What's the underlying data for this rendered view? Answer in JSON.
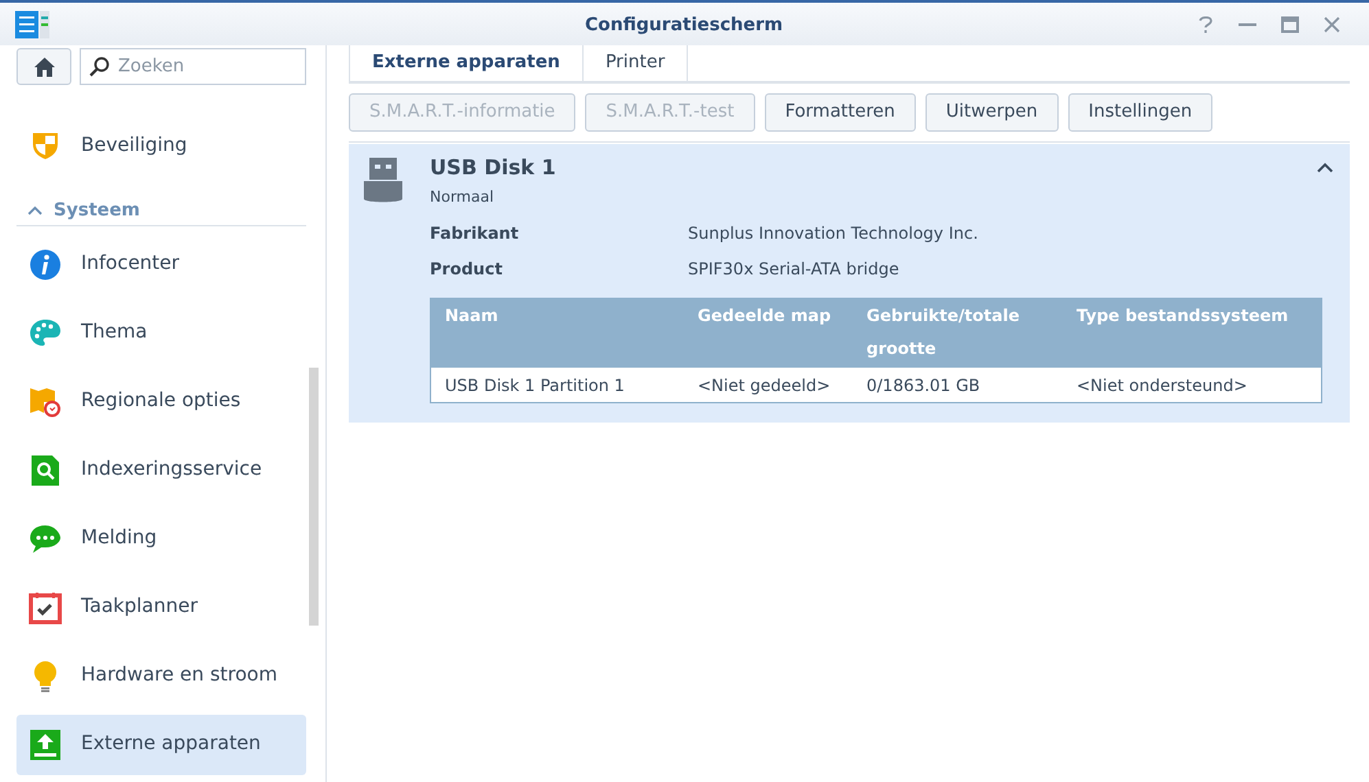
{
  "window": {
    "title": "Configuratiescherm"
  },
  "search": {
    "placeholder": "Zoeken"
  },
  "sidebar": {
    "items": [
      {
        "kind": "shield",
        "label": "Beveiliging",
        "selected": false
      },
      {
        "kind": "group",
        "label": "Systeem",
        "expanded": true
      },
      {
        "kind": "info",
        "label": "Infocenter",
        "selected": false
      },
      {
        "kind": "palette",
        "label": "Thema",
        "selected": false
      },
      {
        "kind": "map",
        "label": "Regionale opties",
        "selected": false
      },
      {
        "kind": "index",
        "label": "Indexeringsservice",
        "selected": false
      },
      {
        "kind": "chat",
        "label": "Melding",
        "selected": false
      },
      {
        "kind": "calendar",
        "label": "Taakplanner",
        "selected": false
      },
      {
        "kind": "bulb",
        "label": "Hardware en stroom",
        "selected": false
      },
      {
        "kind": "upload",
        "label": "Externe apparaten",
        "selected": true
      }
    ]
  },
  "tabs": [
    {
      "label": "Externe apparaten",
      "selected": true
    },
    {
      "label": "Printer",
      "selected": false
    }
  ],
  "toolbar": [
    {
      "label": "S.M.A.R.T.-informatie",
      "disabled": true
    },
    {
      "label": "S.M.A.R.T.-test",
      "disabled": true
    },
    {
      "label": "Formatteren",
      "disabled": false
    },
    {
      "label": "Uitwerpen",
      "disabled": false
    },
    {
      "label": "Instellingen",
      "disabled": false
    }
  ],
  "device": {
    "name": "USB Disk 1",
    "status": "Normaal",
    "expanded": true,
    "properties": [
      {
        "label": "Fabrikant",
        "value": "Sunplus Innovation Technology Inc."
      },
      {
        "label": "Product",
        "value": "SPIF30x Serial-ATA bridge"
      }
    ],
    "table": {
      "columns": [
        "Naam",
        "Gedeelde map",
        "Gebruikte/totale grootte",
        "Type bestandssysteem"
      ],
      "rows": [
        [
          "USB Disk 1 Partition 1",
          "<Niet gedeeld>",
          "0/1863.01 GB",
          "<Niet ondersteund>"
        ]
      ]
    }
  }
}
